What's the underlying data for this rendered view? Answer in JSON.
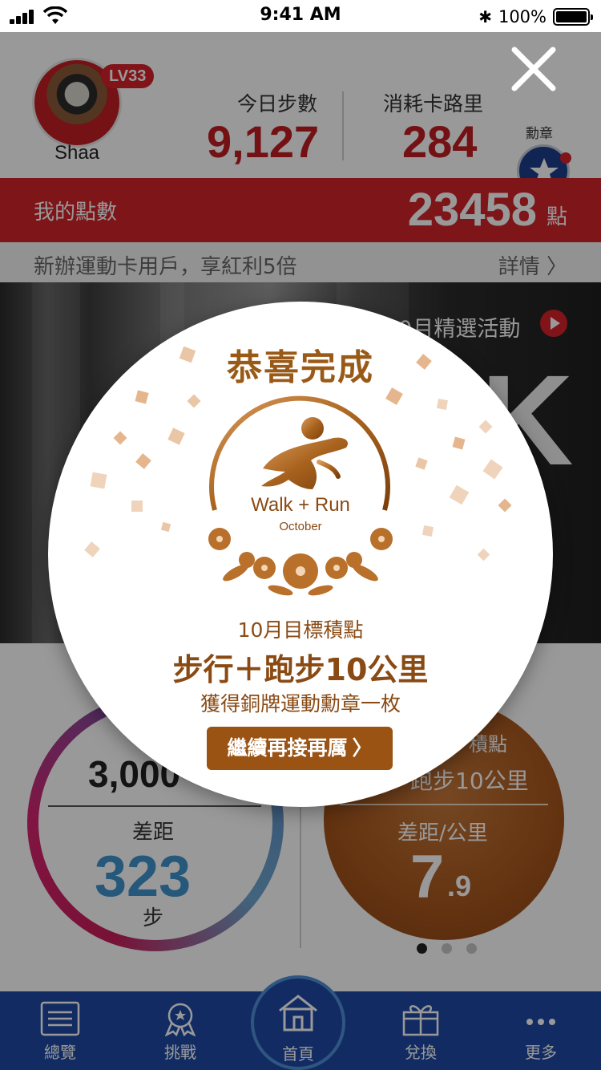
{
  "status_bar": {
    "time": "9:41 AM",
    "battery": "100%"
  },
  "profile": {
    "name": "Shaa",
    "level": "LV33"
  },
  "stats": {
    "steps_label": "今日步數",
    "steps_value": "9,127",
    "calories_label": "消耗卡路里",
    "calories_value": "284",
    "medal_label": "勳章"
  },
  "points": {
    "label": "我的點數",
    "value": "23458",
    "unit": "點"
  },
  "promo": {
    "text": "新辦運動卡用戶，享紅利5倍",
    "detail": "詳情 〉"
  },
  "banner": {
    "title": "10月精選活動",
    "big_letter": "K"
  },
  "goals": {
    "left": {
      "value_text": "3,000",
      "diff_label": "差距",
      "diff_value": "323",
      "unit": "步"
    },
    "right": {
      "head": "積點",
      "main": "跑步10公里",
      "diff_label": "差距/公里",
      "diff_value": "7",
      "diff_decimal": ".9"
    },
    "pages": 3,
    "active_page": 1
  },
  "tabs": [
    {
      "label": "總覽",
      "icon": "list-icon"
    },
    {
      "label": "挑戰",
      "icon": "award-icon"
    },
    {
      "label": "首頁",
      "icon": "home-icon"
    },
    {
      "label": "兌換",
      "icon": "gift-icon"
    },
    {
      "label": "更多",
      "icon": "more-icon"
    }
  ],
  "modal": {
    "title": "恭喜完成",
    "badge_text": "Walk + Run",
    "badge_sub": "October",
    "goal_head": "10月目標積點",
    "goal_main": "步行＋跑步10公里",
    "goal_reward": "獲得銅牌運動勳章一枚",
    "button_label": "繼續再接再厲",
    "button_chevron": "〉"
  },
  "colors": {
    "brand_red": "#d2232a",
    "tab_blue": "#1f4aa6",
    "bronze": "#9a5313",
    "ring_blue": "#3f93cb"
  }
}
